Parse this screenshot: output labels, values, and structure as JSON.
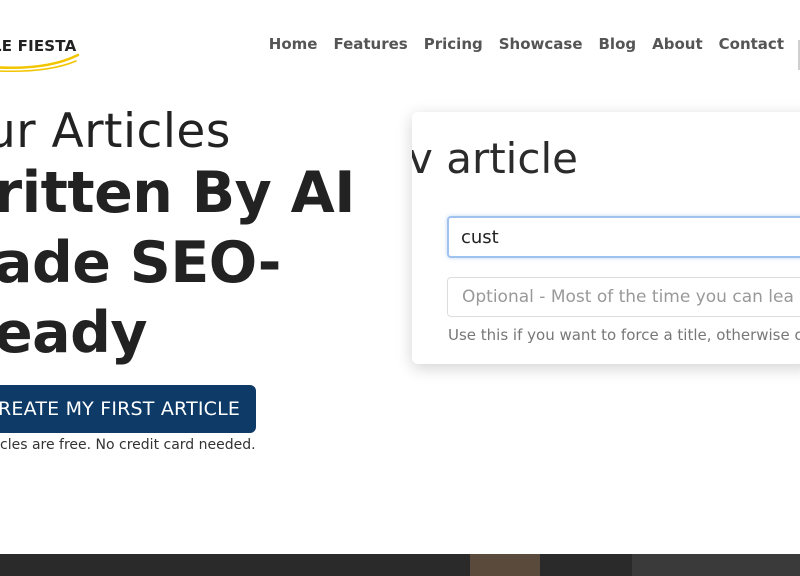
{
  "brand": {
    "logo_text": "LE FIESTA"
  },
  "nav": {
    "items": [
      "Home",
      "Features",
      "Pricing",
      "Showcase",
      "Blog",
      "About",
      "Contact"
    ]
  },
  "hero": {
    "line1": "ur Articles",
    "bold_line1": "ritten By AI",
    "bold_line2": "ade SEO-",
    "bold_line3": "eady",
    "cta_label": "REATE MY FIRST ARTICLE",
    "subtext": "cles are free. No credit card needed."
  },
  "demo": {
    "title": "v article",
    "input_value": "cust",
    "placeholder": "Optional - Most of the time you can lea",
    "hint": "Use this if you want to force a title, otherwise o"
  },
  "colors": {
    "cta": "#0d3a66",
    "logo_swoosh": "#f2c500"
  }
}
